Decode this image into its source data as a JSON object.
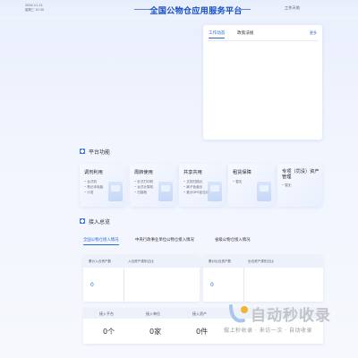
{
  "header": {
    "top_left_line1": "2024-11-12",
    "top_left_line2": "星期三 10:30",
    "title": "全国公物仓应用服务平台",
    "work_link": "工作天地"
  },
  "news": {
    "tabs": [
      {
        "label": "工作动态",
        "active": true
      },
      {
        "label": "政策法规",
        "active": false
      }
    ],
    "more": "更多"
  },
  "platform": {
    "title": "平台功能",
    "cards": [
      {
        "title": "调剂利用",
        "items": [
          "台式机",
          "笔记本电脑",
          "沙发"
        ]
      },
      {
        "title": "周转使用",
        "items": [
          "针式打印机",
          "台式计算机",
          "扫描枪"
        ]
      },
      {
        "title": "共享共用",
        "items": [
          "文档扫描仪",
          "离子色谱仪",
          "差分GPS定位仪"
        ]
      },
      {
        "title": "租赁保障",
        "items": [
          "暂无"
        ]
      },
      {
        "title": "专项（罚没）资产管理",
        "items": [
          "暂无"
        ]
      }
    ]
  },
  "access": {
    "title": "接入总览",
    "tabs": [
      {
        "label": "全国公物仓接入情况",
        "active": true
      },
      {
        "label": "中央行政事业单位公物仓接入情况",
        "active": false
      },
      {
        "label": "省级公物仓接入情况",
        "active": false
      }
    ],
    "box1": {
      "head_left": "累计入仓资产数",
      "head_right": "入仓资产类别占比",
      "value": "0"
    },
    "box2": {
      "head_left": "累计出仓资产数",
      "head_right": "出仓资产类别占比",
      "value": "0"
    },
    "bottom": {
      "headers": [
        "接入平台",
        "接入单位",
        "接入资产"
      ],
      "values": [
        "0个",
        "0家",
        "0件"
      ]
    }
  },
  "watermark": {
    "text": "自动秒收录",
    "sub": "做上秒收录 · 来访一次 · 自动收录"
  }
}
